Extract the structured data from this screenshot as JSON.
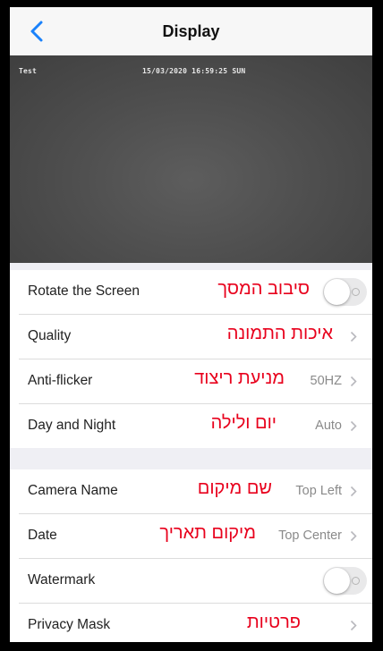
{
  "header": {
    "title": "Display",
    "back_icon": "chevron-left-icon"
  },
  "video": {
    "osd_name": "Test",
    "osd_datetime": "15/03/2020 16:59:25 SUN"
  },
  "settings_group_1": [
    {
      "label": "Rotate the Screen",
      "annotation": "סיבוב המסך",
      "control": "toggle",
      "toggle_on": false
    },
    {
      "label": "Quality",
      "annotation": "איכות התמונה",
      "control": "chevron",
      "value": ""
    },
    {
      "label": "Anti-flicker",
      "annotation": "מניעת ריצוד",
      "control": "chevron",
      "value": "50HZ"
    },
    {
      "label": "Day and Night",
      "annotation": "יום ולילה",
      "control": "chevron",
      "value": "Auto"
    }
  ],
  "settings_group_2": [
    {
      "label": "Camera Name",
      "annotation": "שם מיקום",
      "control": "chevron",
      "value": "Top Left"
    },
    {
      "label": "Date",
      "annotation": "מיקום תאריך",
      "control": "chevron",
      "value": "Top Center"
    },
    {
      "label": "Watermark",
      "annotation": "",
      "control": "toggle",
      "toggle_on": false
    },
    {
      "label": "Privacy Mask",
      "annotation": "פרטיות",
      "control": "chevron",
      "value": ""
    }
  ],
  "colors": {
    "accent": "#1a82fb",
    "annotation_red": "#e8001c",
    "background": "#efeff4"
  }
}
